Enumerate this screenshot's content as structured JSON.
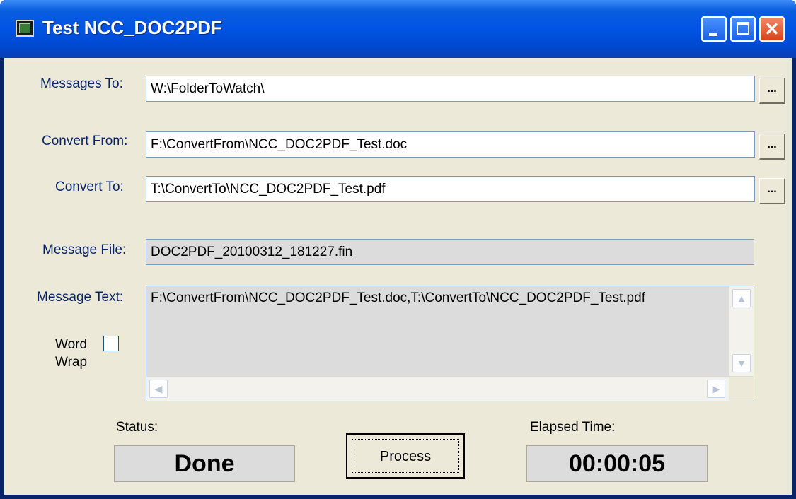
{
  "window": {
    "title": "Test NCC_DOC2PDF"
  },
  "titlebar": {
    "close_glyph": "✕"
  },
  "form": {
    "messages_to": {
      "label": "Messages To:",
      "value": "W:\\FolderToWatch\\",
      "browse": "..."
    },
    "convert_from": {
      "label": "Convert From:",
      "value": "F:\\ConvertFrom\\NCC_DOC2PDF_Test.doc",
      "browse": "..."
    },
    "convert_to": {
      "label": "Convert To:",
      "value": "T:\\ConvertTo\\NCC_DOC2PDF_Test.pdf",
      "browse": "..."
    },
    "message_file": {
      "label": "Message File:",
      "value": "DOC2PDF_20100312_181227.fin"
    },
    "message_text": {
      "label": "Message Text:",
      "value": "F:\\ConvertFrom\\NCC_DOC2PDF_Test.doc,T:\\ConvertTo\\NCC_DOC2PDF_Test.pdf"
    },
    "word_wrap": {
      "label_line1": "Word",
      "label_line2": "Wrap",
      "checked": false
    }
  },
  "status": {
    "label": "Status:",
    "value": "Done"
  },
  "process": {
    "label": "Process"
  },
  "elapsed": {
    "label": "Elapsed Time:",
    "value": "00:00:05"
  },
  "scroll": {
    "up": "▲",
    "down": "▼",
    "left": "◀",
    "right": "▶"
  },
  "colors": {
    "titlebar": "#0054e3",
    "dialog_bg": "#ece9d8",
    "label_text": "#0a246a",
    "close_button": "#d8421a"
  },
  "icons": {
    "app": "app-window-icon"
  }
}
